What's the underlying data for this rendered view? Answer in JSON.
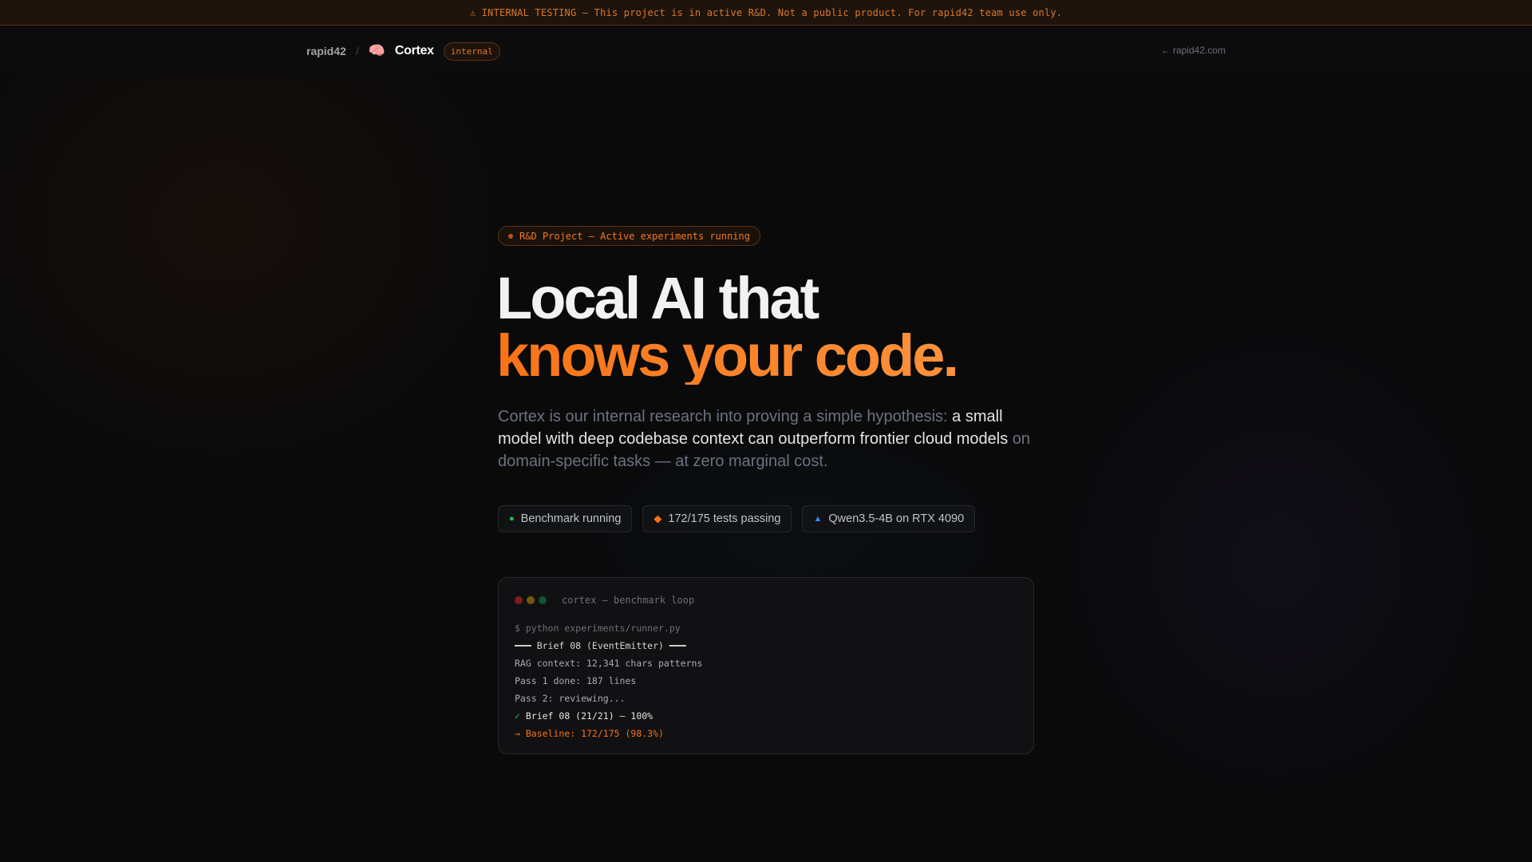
{
  "banner": {
    "text": "⚠ INTERNAL TESTING — This project is in active R&D. Not a public product. For rapid42 team use only."
  },
  "nav": {
    "brand": "rapid42",
    "separator": "/",
    "brain_icon": "🧠",
    "product": "Cortex",
    "tag": "internal",
    "back_link": "← rapid42.com"
  },
  "hero": {
    "pill": "R&D Project — Active experiments running",
    "title_line1": "Local AI that",
    "title_line2": "knows your code.",
    "lead_part1": "Cortex is our internal research into proving a simple hypothesis: ",
    "lead_highlight": "a small model with deep codebase context can outperform frontier cloud models",
    "lead_part2": " on domain-specific tasks — at zero marginal cost."
  },
  "chips": [
    {
      "icon": "●",
      "label": "Benchmark running",
      "color": "#22c55e"
    },
    {
      "icon": "◆",
      "label": "172/175 tests passing",
      "color": "#f97316"
    },
    {
      "icon": "▲",
      "label": "Qwen3.5-4B on RTX 4090",
      "color": "#3b82f6"
    }
  ],
  "terminal": {
    "title": "cortex — benchmark loop",
    "dot_colors": [
      "#7f1d1d",
      "#78540e",
      "#14532d"
    ],
    "lines": [
      "$ python experiments/runner.py",
      "━━━ Brief 08 (EventEmitter) ━━━",
      "RAG context: 12,341 chars patterns",
      "Pass 1 done: 187 lines",
      "Pass 2: reviewing..."
    ],
    "ok_mark": "✓",
    "ok_text": " Brief 08 (21/21) — 100%",
    "baseline": "→ Baseline: 172/175 (98.3%)"
  }
}
